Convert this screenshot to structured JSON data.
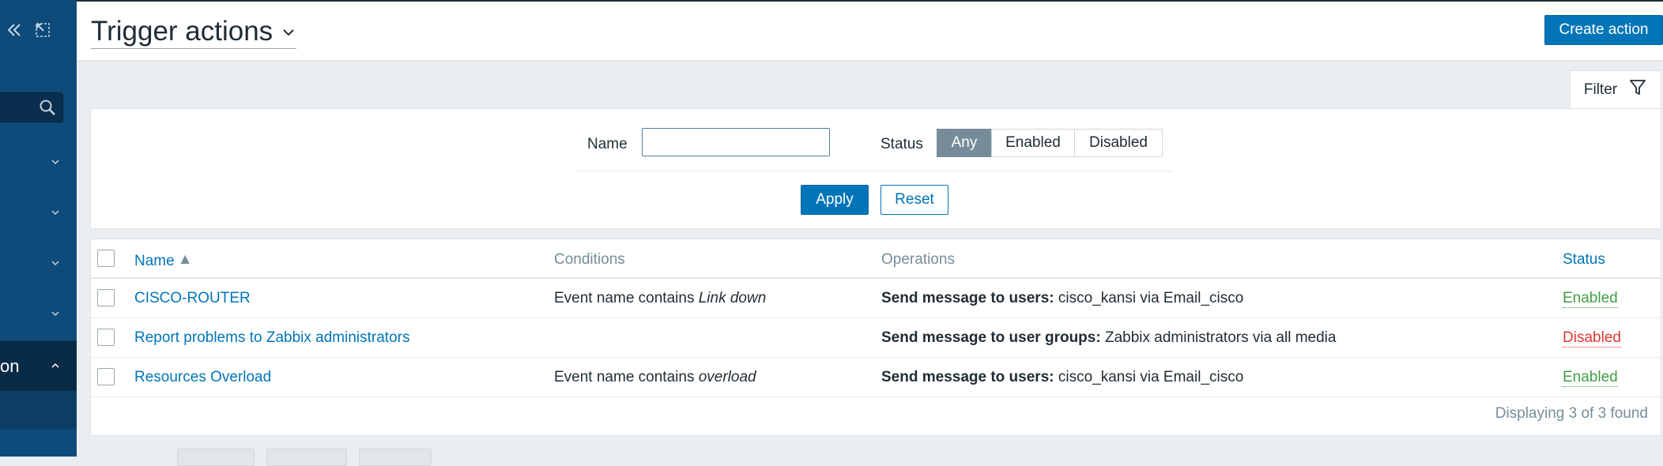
{
  "sidebar": {
    "collapse_icon": "double-chevron-left-icon",
    "undock_icon": "undock-icon",
    "search_icon": "search-icon",
    "active_label": "on"
  },
  "header": {
    "title": "Trigger actions",
    "create_label": "Create action"
  },
  "filter": {
    "tab_label": "Filter",
    "name_label": "Name",
    "name_value": "",
    "status_label": "Status",
    "status_options": [
      "Any",
      "Enabled",
      "Disabled"
    ],
    "status_selected": "Any",
    "apply_label": "Apply",
    "reset_label": "Reset"
  },
  "table": {
    "columns": {
      "name": "Name",
      "conditions": "Conditions",
      "operations": "Operations",
      "status": "Status"
    },
    "rows": [
      {
        "name": "CISCO-ROUTER",
        "cond_prefix": "Event name contains ",
        "cond_value": "Link down",
        "op_bold": "Send message to users:",
        "op_rest": " cisco_kansi via Email_cisco",
        "status": "Enabled"
      },
      {
        "name": "Report problems to Zabbix administrators",
        "cond_prefix": "",
        "cond_value": "",
        "op_bold": "Send message to user groups:",
        "op_rest": " Zabbix administrators via all media",
        "status": "Disabled"
      },
      {
        "name": "Resources Overload",
        "cond_prefix": "Event name contains ",
        "cond_value": "overload",
        "op_bold": "Send message to users:",
        "op_rest": " cisco_kansi via Email_cisco",
        "status": "Enabled"
      }
    ],
    "footer": "Displaying 3 of 3 found"
  },
  "colors": {
    "accent": "#0275b8",
    "sidebar": "#0e4a7a",
    "enabled": "#429e47",
    "disabled": "#e33734"
  }
}
